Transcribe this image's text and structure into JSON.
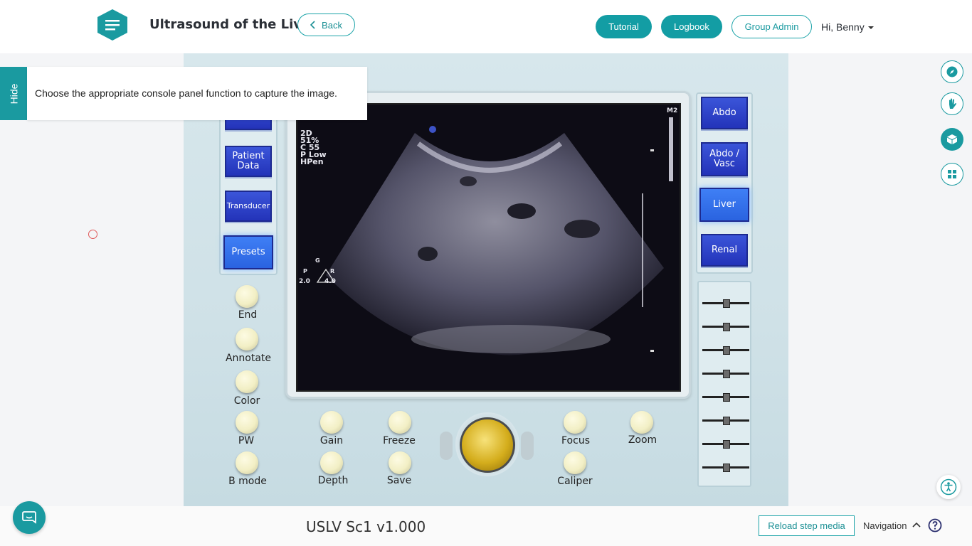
{
  "header": {
    "title": "Ultrasound of the Liver",
    "back_label": "Back",
    "tutorial_label": "Tutorial",
    "logbook_label": "Logbook",
    "group_admin_label": "Group Admin",
    "user_greeting": "Hi, Benny"
  },
  "instruction": {
    "hide_label": "Hide",
    "text": "Choose the appropriate console panel function to capture the image."
  },
  "console": {
    "left_buttons": [
      "Patient Data",
      "Transducer",
      "Presets"
    ],
    "active_left": "Presets",
    "right_buttons": [
      "Abdo",
      "Abdo / Vasc",
      "Liver",
      "Renal"
    ],
    "active_right": "Liver",
    "knobs_left": [
      "End",
      "Annotate",
      "Color",
      "PW",
      "B mode"
    ],
    "knobs_bottom_row1": [
      "Gain",
      "Freeze",
      "Focus",
      "Zoom"
    ],
    "knobs_bottom_row2": [
      "Depth",
      "Save",
      "Caliper"
    ],
    "screen_text": {
      "corner": "M2",
      "mode": "2D",
      "percent": "51%",
      "c": "C 55",
      "p": "P Low",
      "hpen": "HPen",
      "probe_left": "2.0",
      "probe_right": "4.0",
      "g": "G",
      "r": "R",
      "p_marker": "P"
    }
  },
  "footer": {
    "version": "USLV Sc1 v1.000",
    "reload_label": "Reload step media",
    "navigation_label": "Navigation"
  },
  "colors": {
    "accent": "#1a9aa0",
    "console_button": "#2a3bc4",
    "console_button_active": "#3478ee"
  }
}
